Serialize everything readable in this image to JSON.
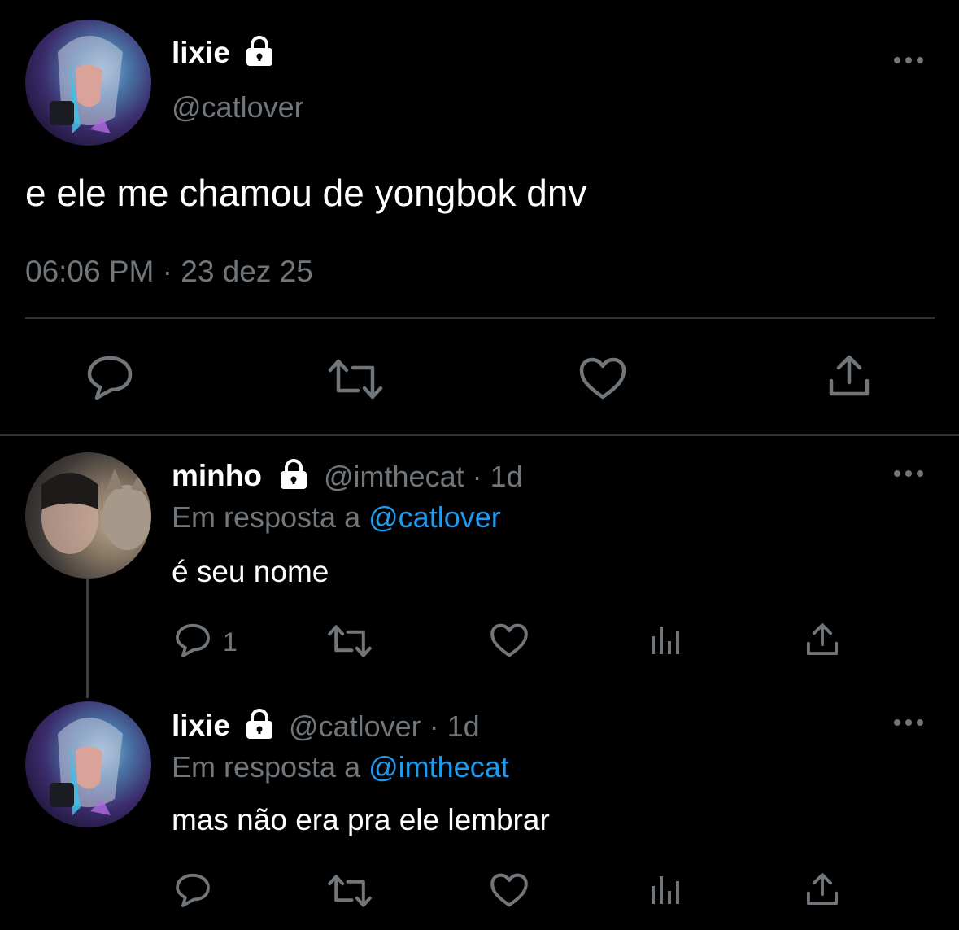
{
  "main_tweet": {
    "display_name": "lixie",
    "handle": "@catlover",
    "text": "e ele me chamou de yongbok dnv",
    "timestamp": "06:06 PM · 23 dez 25"
  },
  "replies": [
    {
      "display_name": "minho",
      "handle_time": "@imthecat · 1d",
      "reply_prefix": "Em resposta a",
      "reply_to": "@catlover",
      "text": "é seu nome",
      "reply_count": "1"
    },
    {
      "display_name": "lixie",
      "handle_time": "@catlover · 1d",
      "reply_prefix": "Em resposta a",
      "reply_to": "@imthecat",
      "text": "mas não era pra ele lembrar",
      "reply_count": ""
    }
  ],
  "icons": [
    "lock-icon",
    "more-icon",
    "reply-icon",
    "retweet-icon",
    "like-icon",
    "views-icon",
    "share-icon"
  ],
  "colors": {
    "background": "#000000",
    "text": "#e7e9ea",
    "muted": "#71767b",
    "link": "#1d9bf0",
    "divider": "#2f3336"
  }
}
